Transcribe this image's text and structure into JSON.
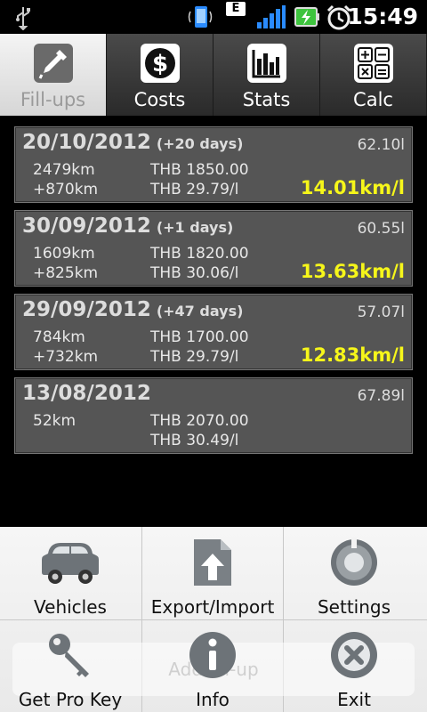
{
  "status_bar": {
    "time": "15:49",
    "network_type": "E",
    "icons": [
      "usb-icon",
      "phone-icon",
      "network-e-icon",
      "signal-icon",
      "battery-charging-icon",
      "alarm-icon"
    ]
  },
  "tabs": [
    {
      "label": "Fill-ups",
      "icon": "fuel-pump-icon",
      "active": true
    },
    {
      "label": "Costs",
      "icon": "dollar-icon",
      "active": false
    },
    {
      "label": "Stats",
      "icon": "bar-chart-icon",
      "active": false
    },
    {
      "label": "Calc",
      "icon": "calculator-icon",
      "active": false
    }
  ],
  "fillups": [
    {
      "date": "20/10/2012",
      "days": "(+20 days)",
      "volume": "62.10l",
      "odometer": "2479km",
      "distance": "+870km",
      "price": "THB 1850.00",
      "price_per_l": "THB 29.79/l",
      "efficiency": "14.01km/l"
    },
    {
      "date": "30/09/2012",
      "days": "(+1 days)",
      "volume": "60.55l",
      "odometer": "1609km",
      "distance": "+825km",
      "price": "THB 1820.00",
      "price_per_l": "THB 30.06/l",
      "efficiency": "13.63km/l"
    },
    {
      "date": "29/09/2012",
      "days": "(+47 days)",
      "volume": "57.07l",
      "odometer": "784km",
      "distance": "+732km",
      "price": "THB 1700.00",
      "price_per_l": "THB 29.79/l",
      "efficiency": "12.83km/l"
    },
    {
      "date": "13/08/2012",
      "days": "",
      "volume": "67.89l",
      "odometer": "52km",
      "distance": "",
      "price": "THB 2070.00",
      "price_per_l": "THB 30.49/l",
      "efficiency": ""
    }
  ],
  "menu": [
    {
      "label": "Vehicles",
      "icon": "car-icon"
    },
    {
      "label": "Export/Import",
      "icon": "export-import-icon"
    },
    {
      "label": "Settings",
      "icon": "settings-icon"
    },
    {
      "label": "Get Pro Key",
      "icon": "key-icon"
    },
    {
      "label": "Info",
      "icon": "info-icon"
    },
    {
      "label": "Exit",
      "icon": "exit-icon"
    }
  ],
  "hidden_button_label": "Add fill-up",
  "colors": {
    "efficiency": "#f6f61a",
    "card_bg": "#555555",
    "menu_bg": "#f0f0f0"
  }
}
